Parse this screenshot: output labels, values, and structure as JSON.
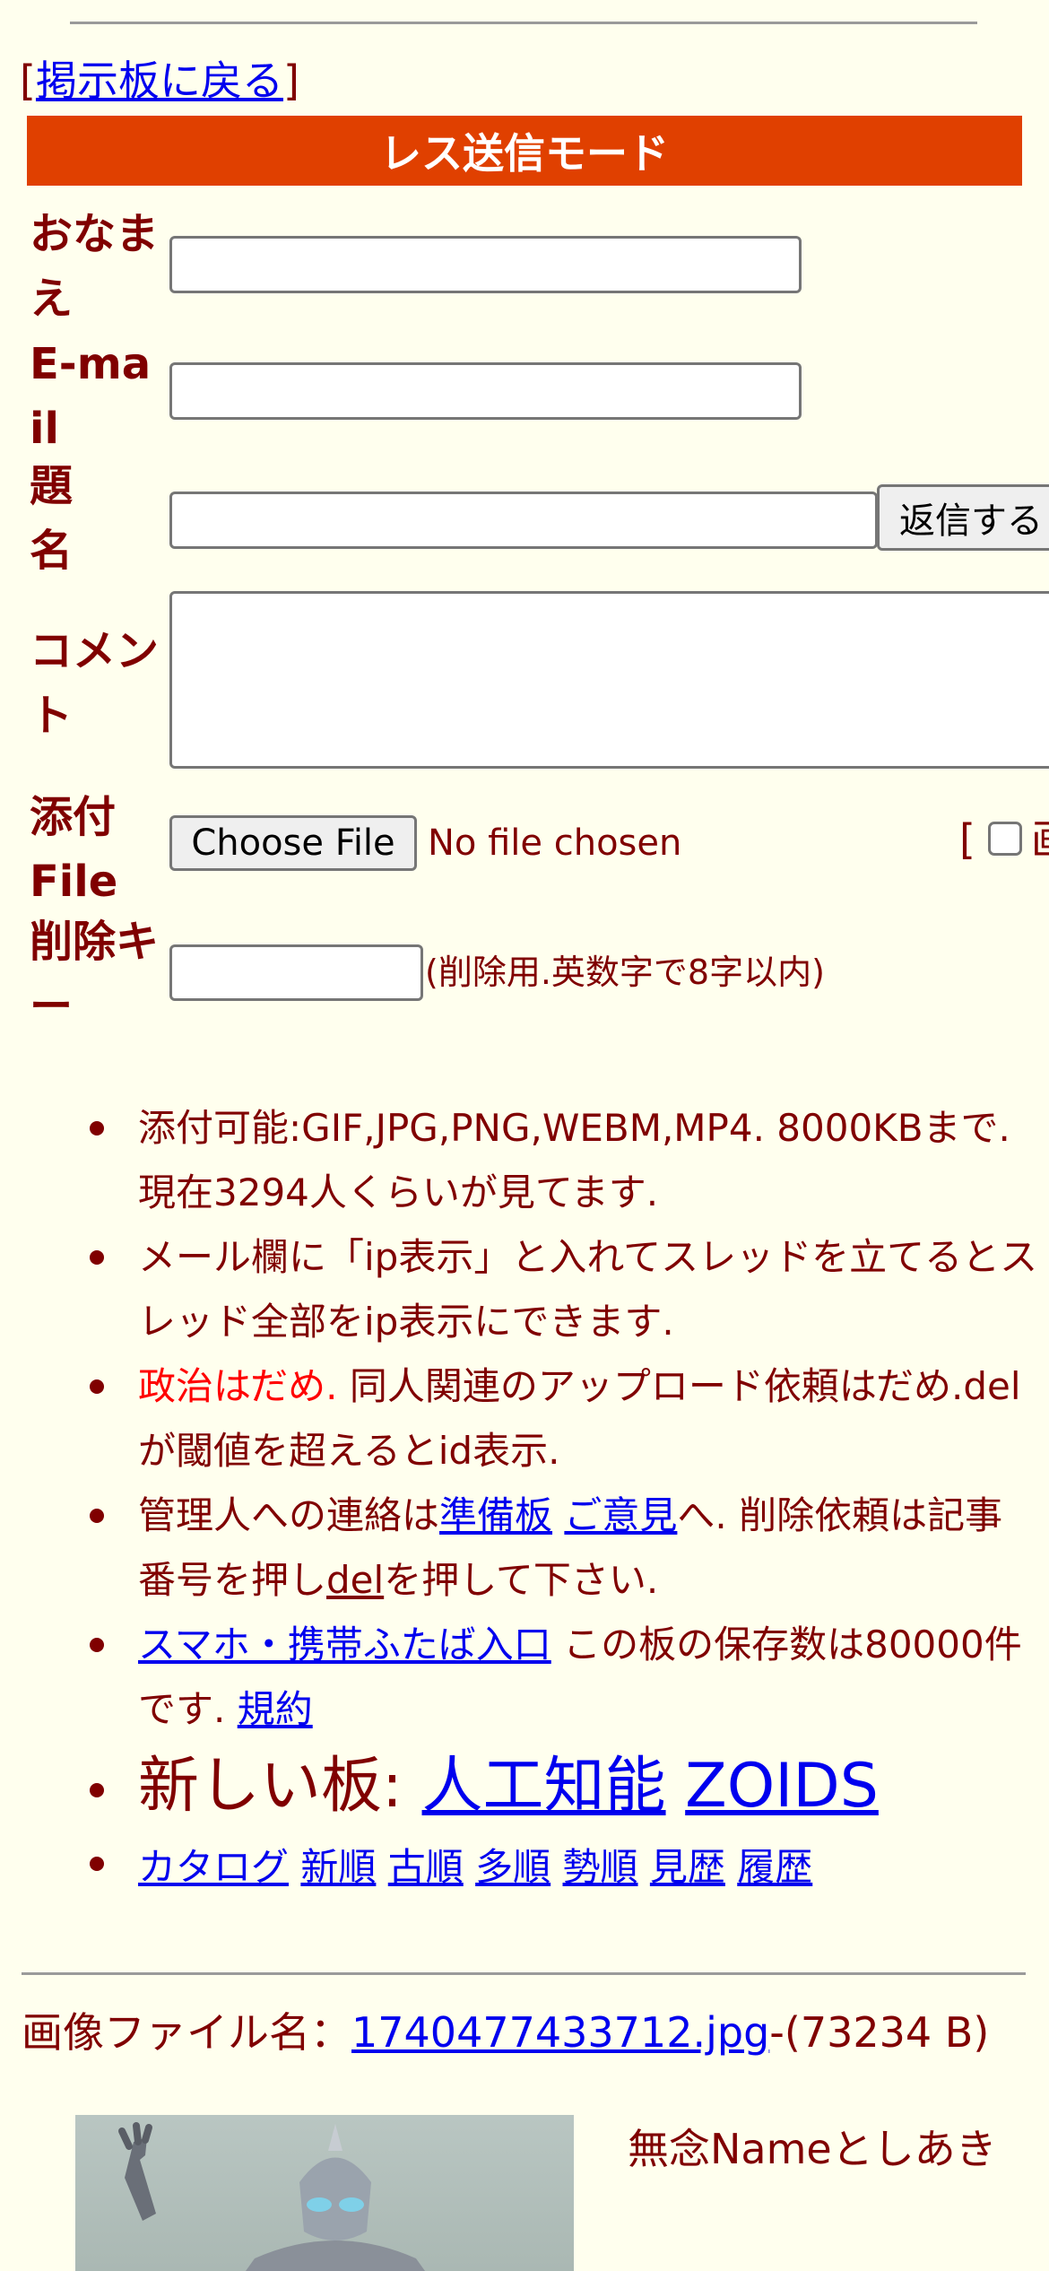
{
  "back_link": {
    "open": "[",
    "label": "掲示板に戻る",
    "close": "]"
  },
  "mode_title": "レス送信モード",
  "form": {
    "name_label": "おなまえ",
    "email_label": "E-mail",
    "subject_label": "題名",
    "submit_label": "返信する",
    "comment_label": "コメント",
    "file_label": "添付File",
    "choose_file_label": "Choose File",
    "no_file_text": "No file chosen",
    "image_checkbox_text": "[",
    "image_checkbox_tail": "画",
    "delete_key_label": "削除キー",
    "delete_key_hint": "(削除用.英数字で8字以内)"
  },
  "notes": {
    "n1": "添付可能:GIF,JPG,PNG,WEBM,MP4. 8000KBまで. 現在3294人くらいが見てます.",
    "n2": "メール欄に「ip表示」と入れてスレッドを立てるとスレッド全部をip表示にできます.",
    "n3_red": "政治はだめ.",
    "n3_rest": " 同人関連のアップロード依頼はだめ.delが閾値を超えるとid表示.",
    "n4_a": "管理人への連絡は",
    "n4_link1": "準備板",
    "n4_link2": "ご意見",
    "n4_b": "へ. 削除依頼は記事番号を押し",
    "n4_link3": "del",
    "n4_c": "を押して下さい.",
    "n5_link": "スマホ・携帯ふたば入口",
    "n5_text": " この板の保存数は80000件です. ",
    "n5_link2": "規約",
    "n6_prefix": "新しい板: ",
    "n6_link1": "人工知能",
    "n6_link2": "ZOIDS",
    "nav": [
      "カタログ",
      "新順",
      "古順",
      "多順",
      "勢順",
      "見歴",
      "履歴"
    ]
  },
  "post": {
    "file_prefix": "画像ファイル名：",
    "file_name": "1740477433712.jpg",
    "file_size": "-(73234 B)",
    "poster": "無念Nameとしあき"
  }
}
